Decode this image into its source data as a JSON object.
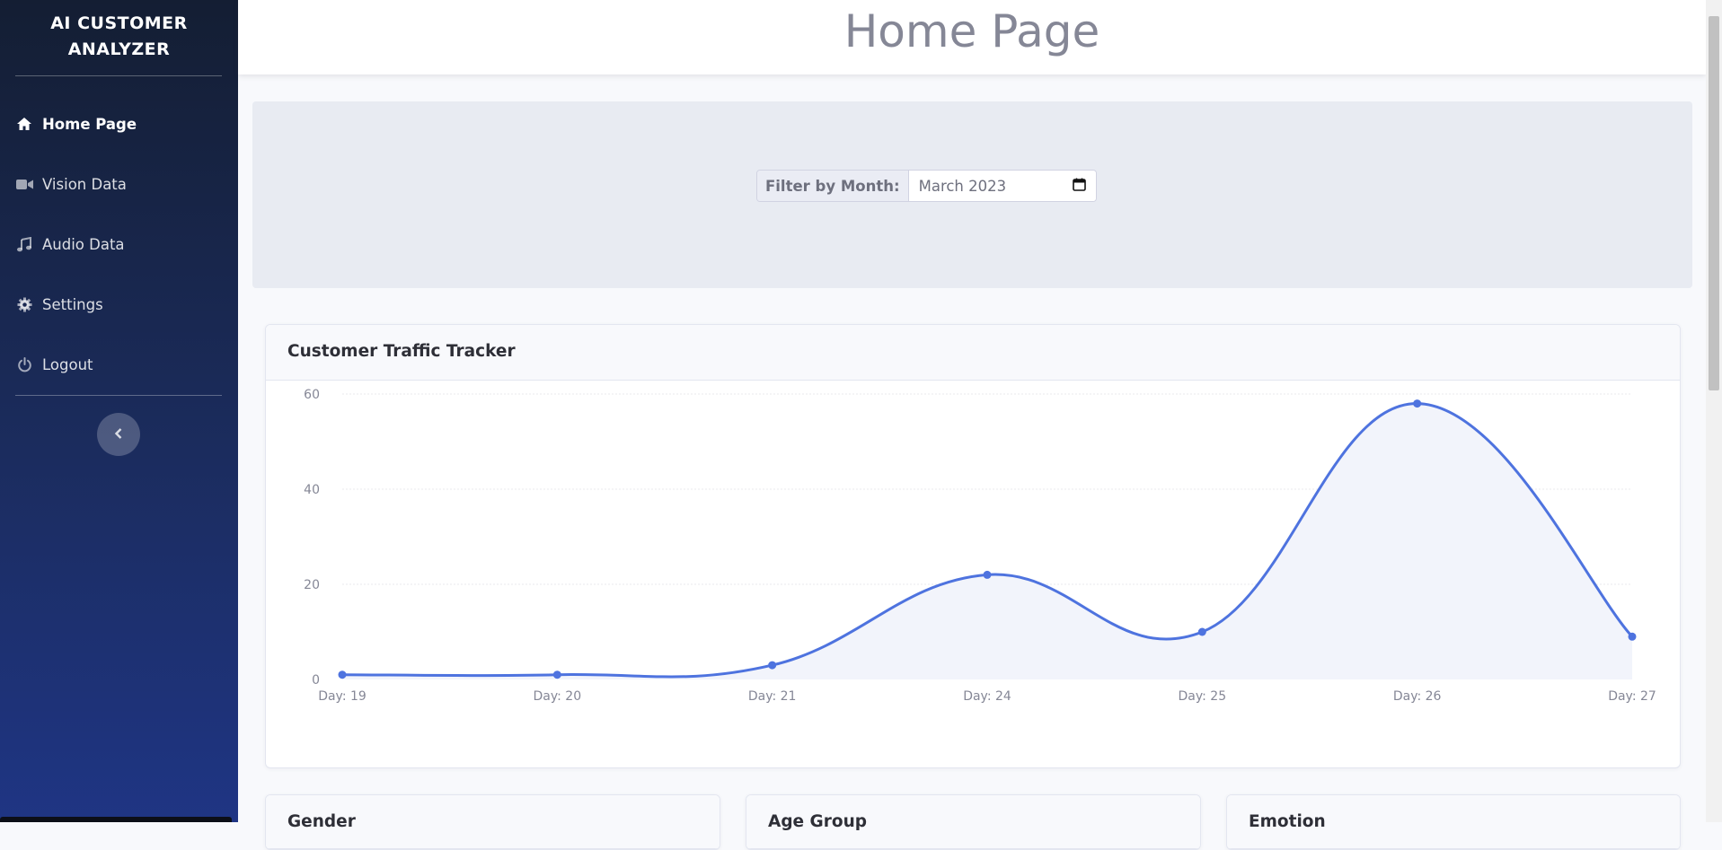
{
  "sidebar": {
    "brand_line1": "AI CUSTOMER",
    "brand_line2": "ANALYZER",
    "items": [
      {
        "label": "Home Page",
        "icon": "home-icon",
        "active": true
      },
      {
        "label": "Vision Data",
        "icon": "video-camera-icon",
        "active": false
      },
      {
        "label": "Audio Data",
        "icon": "music-note-icon",
        "active": false
      },
      {
        "label": "Settings",
        "icon": "gear-icon",
        "active": false
      },
      {
        "label": "Logout",
        "icon": "power-icon",
        "active": false
      }
    ],
    "collapse_icon": "chevron-left-icon"
  },
  "header": {
    "title": "Home Page"
  },
  "filter": {
    "label": "Filter by Month:",
    "value": "March  2023",
    "icon": "calendar-icon"
  },
  "chart_card": {
    "title": "Customer Traffic Tracker"
  },
  "chart_data": {
    "type": "line",
    "title": "",
    "xlabel": "",
    "ylabel": "",
    "categories": [
      "Day: 19",
      "Day: 20",
      "Day: 21",
      "Day: 24",
      "Day: 25",
      "Day: 26",
      "Day: 27"
    ],
    "series": [
      {
        "values": [
          1,
          1,
          3,
          22,
          10,
          58,
          9
        ]
      }
    ],
    "ylim": [
      0,
      60
    ],
    "yticks": [
      0,
      20,
      40,
      60
    ],
    "grid": true,
    "line_color": "#4e73df",
    "fill_color": "#f2f4fb"
  },
  "bottom_cards": [
    {
      "title": "Gender"
    },
    {
      "title": "Age Group"
    },
    {
      "title": "Emotion"
    }
  ],
  "colors": {
    "accent": "#4e73df",
    "sidebar_top": "#141e33",
    "sidebar_bottom": "#1f3584"
  }
}
